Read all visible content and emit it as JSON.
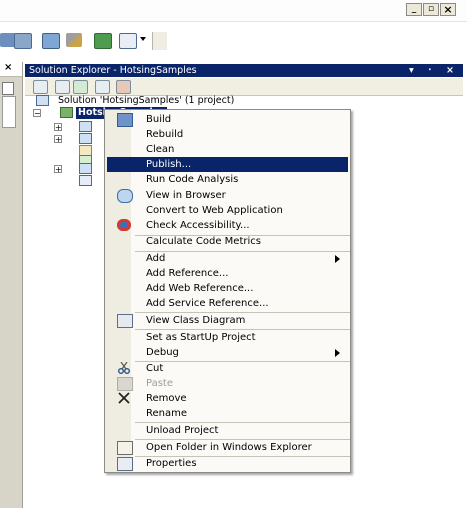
{
  "window": {
    "min_label": "_",
    "max_label": "▫",
    "close_label": "×"
  },
  "left_panel": {
    "close_label": "×"
  },
  "solution_explorer": {
    "title": "Solution Explorer - HotsingSamples",
    "title_controls": "▾ ᛫ ×",
    "solution_node": "Solution 'HotsingSamples' (1 project)",
    "project_node": "HotsingSamples"
  },
  "context_menu": {
    "items": [
      {
        "label": "Build",
        "icon": "build-icon"
      },
      {
        "label": "Rebuild"
      },
      {
        "label": "Clean"
      },
      {
        "label": "Publish...",
        "selected": true
      },
      {
        "label": "Run Code Analysis"
      },
      {
        "label": "View in Browser",
        "icon": "browser-icon"
      },
      {
        "label": "Convert to Web Application"
      },
      {
        "label": "Check Accessibility...",
        "icon": "accessibility-icon"
      },
      {
        "label": "Calculate Code Metrics"
      },
      {
        "label": "Add",
        "submenu": true
      },
      {
        "label": "Add Reference..."
      },
      {
        "label": "Add Web Reference..."
      },
      {
        "label": "Add Service Reference..."
      },
      {
        "label": "View Class Diagram",
        "icon": "class-diagram-icon"
      },
      {
        "label": "Set as StartUp Project"
      },
      {
        "label": "Debug",
        "submenu": true
      },
      {
        "label": "Cut",
        "icon": "scissors-icon"
      },
      {
        "label": "Paste",
        "icon": "paste-icon",
        "disabled": true
      },
      {
        "label": "Remove",
        "icon": "remove-icon"
      },
      {
        "label": "Rename"
      },
      {
        "label": "Unload Project"
      },
      {
        "label": "Open Folder in Windows Explorer",
        "icon": "open-folder-icon"
      },
      {
        "label": "Properties",
        "icon": "properties-icon"
      }
    ]
  },
  "colors": {
    "selection": "#0a246a",
    "menu_background": "#fbfaf7",
    "gutter": "#efede2",
    "toolwindow_strip": "#f1efe2"
  }
}
